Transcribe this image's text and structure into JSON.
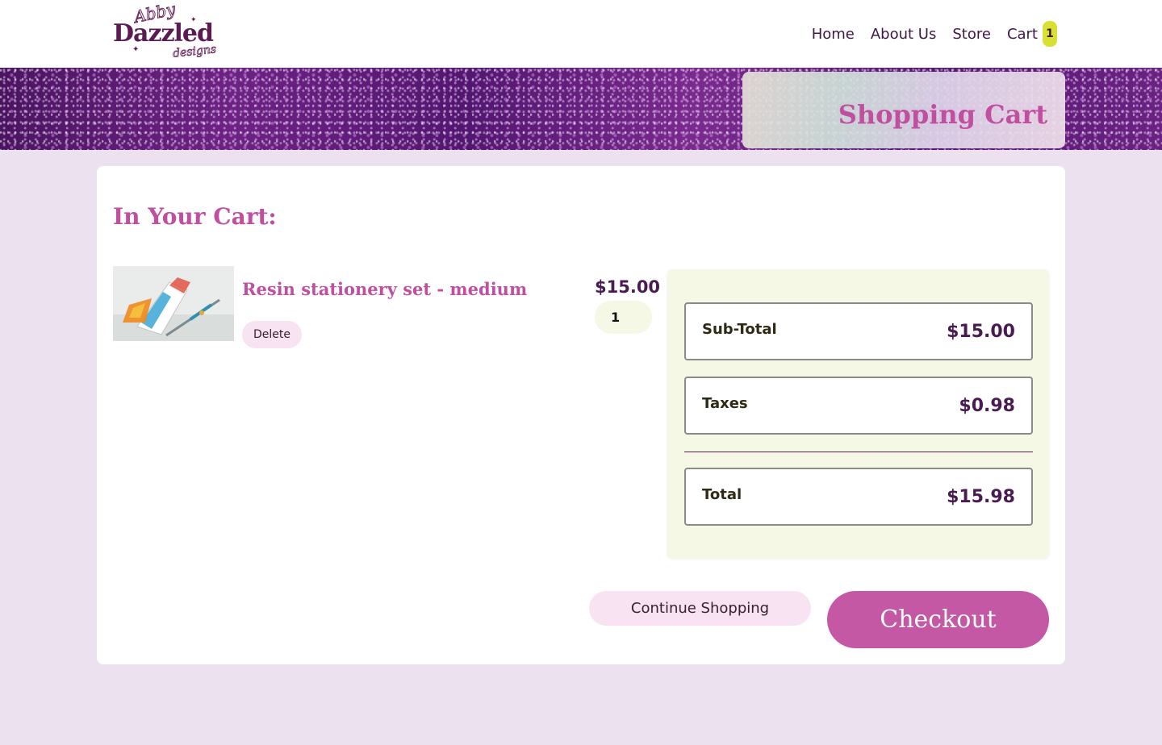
{
  "brand": {
    "logo_line1": "Abby",
    "logo_line2": "Dazzled",
    "logo_line3": "designs"
  },
  "nav": {
    "items": [
      {
        "label": "Home"
      },
      {
        "label": "About Us"
      },
      {
        "label": "Store"
      },
      {
        "label": "Cart"
      }
    ],
    "cart_count": "1"
  },
  "banner": {
    "title": "Shopping Cart"
  },
  "cart": {
    "heading": "In Your Cart:",
    "items": [
      {
        "name": "Resin stationery set - medium",
        "price": "$15.00",
        "quantity": "1",
        "delete_label": "Delete"
      }
    ]
  },
  "summary": {
    "subtotal_label": "Sub-Total",
    "subtotal_value": "$15.00",
    "taxes_label": "Taxes",
    "taxes_value": "$0.98",
    "total_label": "Total",
    "total_value": "$15.98"
  },
  "actions": {
    "continue_label": "Continue Shopping",
    "checkout_label": "Checkout"
  },
  "colors": {
    "accent": "#c04f9f",
    "page_bg": "#ece1ef",
    "badge": "#d8e033",
    "summary_bg": "#f6f8e6"
  }
}
